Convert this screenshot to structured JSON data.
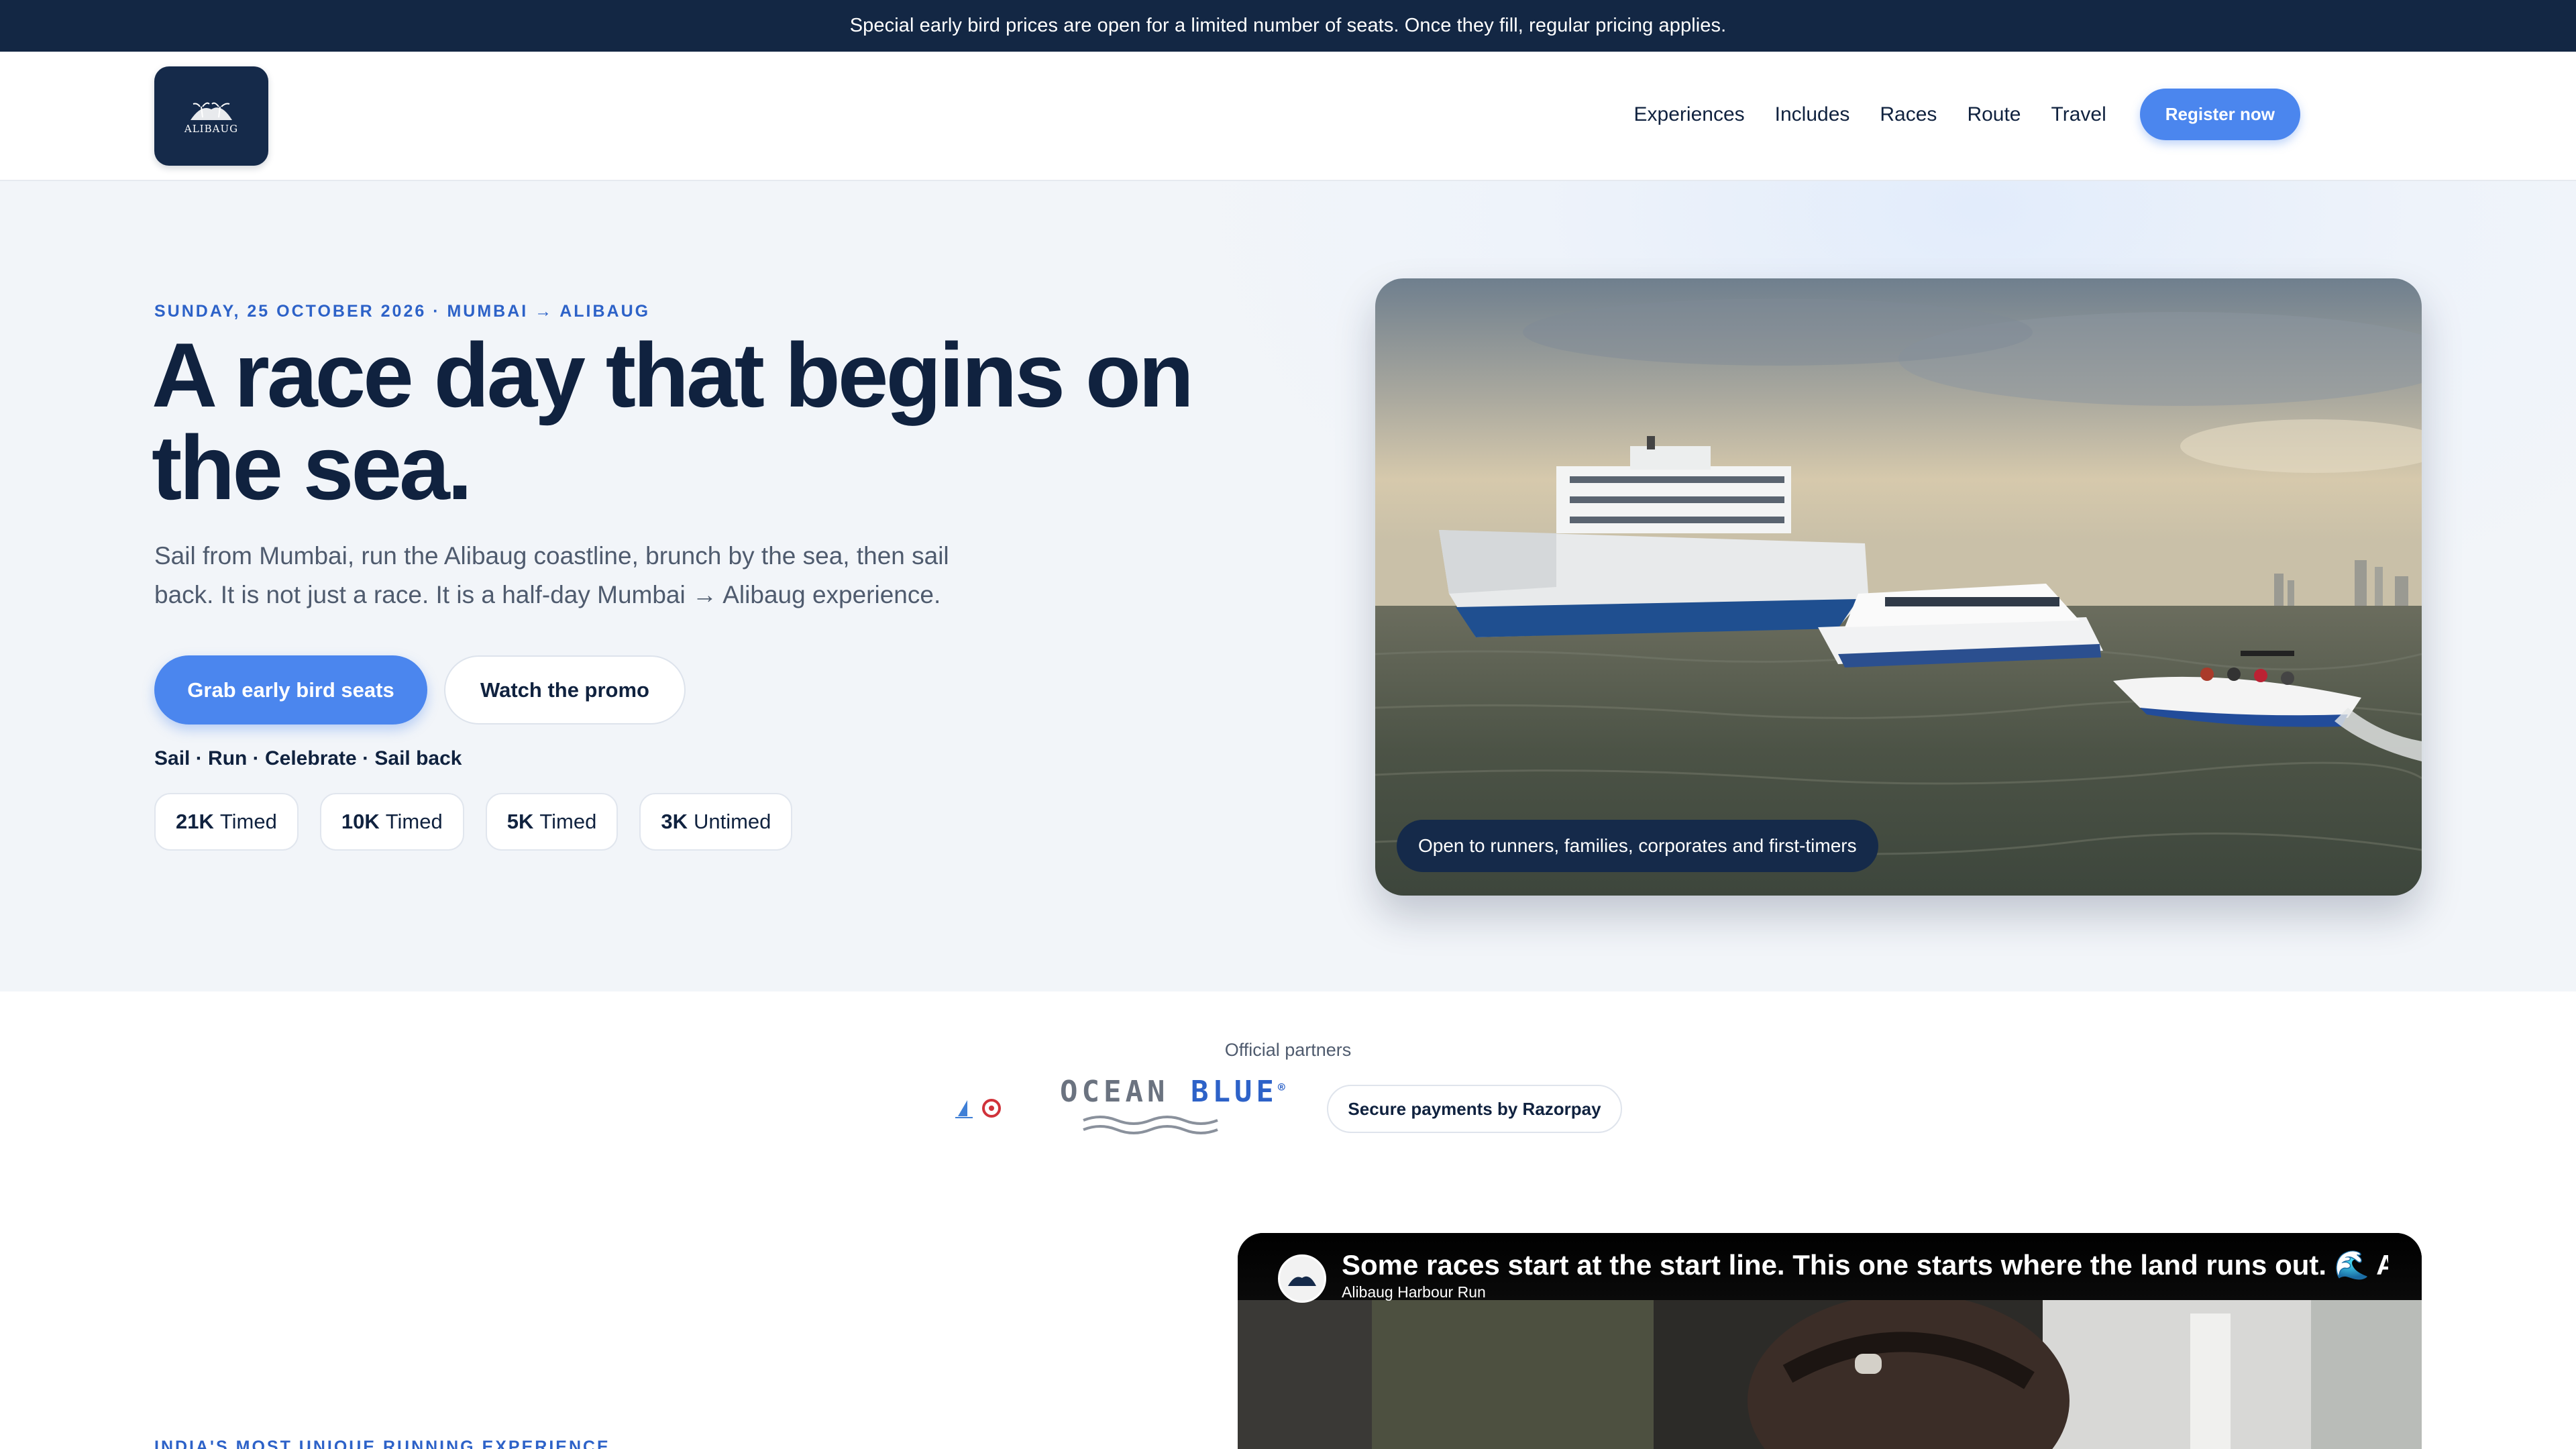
{
  "announcement": "Special early bird prices are open for a limited number of seats. Once they fill, regular pricing applies.",
  "header": {
    "logo_text": "ALIBAUG",
    "nav": [
      "Experiences",
      "Includes",
      "Races",
      "Route",
      "Travel"
    ],
    "cta": "Register now"
  },
  "hero": {
    "eyebrow": "SUNDAY, 25 OCTOBER 2026 · MUMBAI → ALIBAUG",
    "headline": "A race day that begins on the sea.",
    "lead": "Sail from Mumbai, run the Alibaug coastline, brunch by the sea, then sail back. It is not just a race. It is a half-day Mumbai → Alibaug experience.",
    "primary_button": "Grab early bird seats",
    "secondary_button": "Watch the promo",
    "taglets": "Sail · Run · Celebrate · Sail back",
    "chips": [
      {
        "distance": "21K",
        "type": "Timed"
      },
      {
        "distance": "10K",
        "type": "Timed"
      },
      {
        "distance": "5K",
        "type": "Timed"
      },
      {
        "distance": "3K",
        "type": "Untimed"
      }
    ],
    "image_caption": "Open to runners, families, corporates and first-timers"
  },
  "partners": {
    "label": "Official partners",
    "ocean_blue_1": "OCEAN ",
    "ocean_blue_2": "BLUE",
    "ocean_blue_mark": "®",
    "payments": "Secure payments by Razorpay"
  },
  "section2": {
    "eyebrow": "INDIA'S MOST UNIQUE RUNNING EXPERIENCE"
  },
  "video": {
    "title": "Some races start at the start line. This one starts where the land runs out. 🌊 Alibaug Harbour Run",
    "channel": "Alibaug Harbour Run"
  },
  "colors": {
    "navy": "#132744",
    "accent": "#4b86ee",
    "eyebrow": "#2d62c8"
  }
}
